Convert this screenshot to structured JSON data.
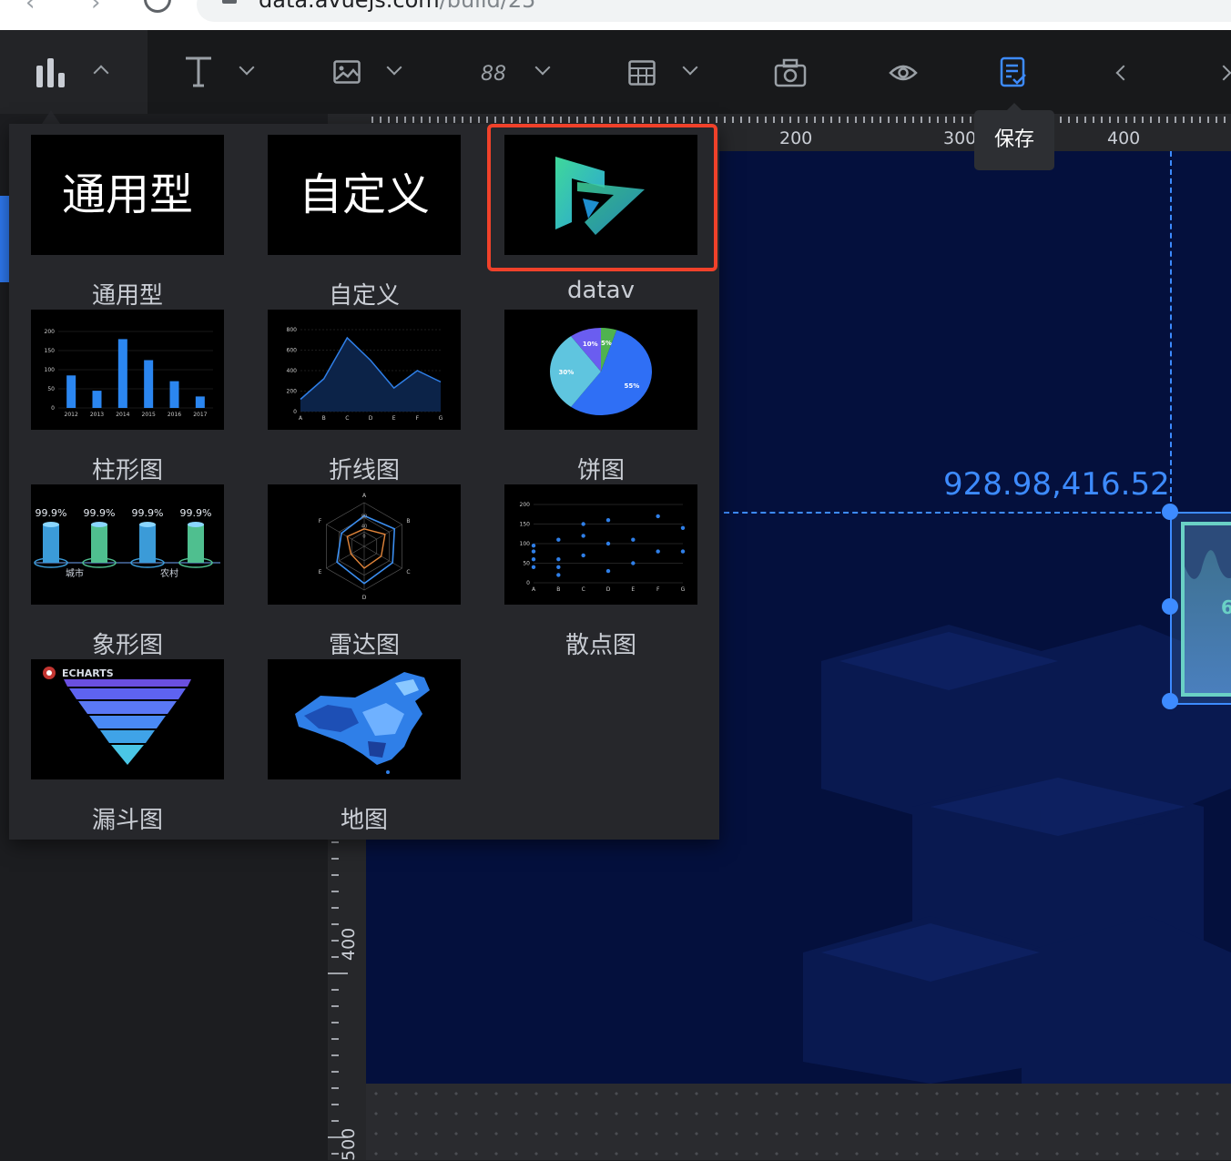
{
  "browser": {
    "url_host": "data.avuejs.com",
    "url_path": "/build/25"
  },
  "toolbar": {
    "tools": [
      {
        "icon": "bar-chart-icon",
        "active": true
      },
      {
        "icon": "text-icon"
      },
      {
        "icon": "image-icon"
      },
      {
        "icon": "digital-number-icon"
      },
      {
        "icon": "table-icon"
      },
      {
        "icon": "camera-icon"
      },
      {
        "icon": "eye-icon"
      },
      {
        "icon": "save-icon",
        "color": "#3d8bff"
      },
      {
        "icon": "chevron-left-icon"
      }
    ],
    "save_tooltip": "保存"
  },
  "ruler": {
    "top_labels": [
      "200",
      "300",
      "400"
    ],
    "left_labels": [
      "400",
      "500"
    ]
  },
  "canvas": {
    "background": "#04103d",
    "coordinate_readout": "928.98,416.52",
    "widget_partial_text": "6"
  },
  "chart_menu": {
    "items": [
      {
        "label": "通用型",
        "thumb_text": "通用型"
      },
      {
        "label": "自定义",
        "thumb_text": "自定义"
      },
      {
        "label": "datav",
        "selected": true
      },
      {
        "label": "柱形图"
      },
      {
        "label": "折线图"
      },
      {
        "label": "饼图"
      },
      {
        "label": "象形图"
      },
      {
        "label": "雷达图"
      },
      {
        "label": "散点图"
      },
      {
        "label": "漏斗图"
      },
      {
        "label": "地图"
      }
    ],
    "bar_thumb": {
      "categories": [
        "2012",
        "2013",
        "2014",
        "2015",
        "2016",
        "2017"
      ],
      "values": [
        85,
        45,
        180,
        125,
        70,
        30
      ],
      "y_ticks": [
        "0",
        "50",
        "100",
        "150",
        "200"
      ]
    },
    "line_thumb": {
      "categories": [
        "A",
        "B",
        "C",
        "D",
        "E",
        "F",
        "G"
      ],
      "values": [
        120,
        320,
        720,
        500,
        230,
        400,
        290
      ],
      "y_ticks": [
        "0",
        "200",
        "400",
        "600",
        "800"
      ]
    },
    "pie_thumb": {
      "slices": [
        {
          "label": "55%",
          "value": 55,
          "color": "#2f6ff5"
        },
        {
          "label": "30%",
          "value": 30,
          "color": "#5fc5df"
        },
        {
          "label": "10%",
          "value": 10,
          "color": "#6a5df0"
        },
        {
          "label": "5%",
          "value": 5,
          "color": "#4fb34f"
        }
      ]
    },
    "pictorial_thumb": {
      "values": [
        "99.9%",
        "99.9%",
        "99.9%",
        "99.9%"
      ],
      "labels": [
        "城市",
        "农村"
      ]
    },
    "radar_thumb": {
      "axes": [
        "A",
        "B",
        "C",
        "D",
        "E",
        "F"
      ],
      "ticks": [
        "80",
        "40",
        "0"
      ]
    },
    "scatter_thumb": {
      "categories": [
        "A",
        "B",
        "C",
        "D",
        "E",
        "F",
        "G"
      ],
      "y_ticks": [
        "0",
        "50",
        "100",
        "150",
        "200"
      ]
    },
    "funnel_thumb": {
      "brand": "ECHARTS"
    }
  }
}
